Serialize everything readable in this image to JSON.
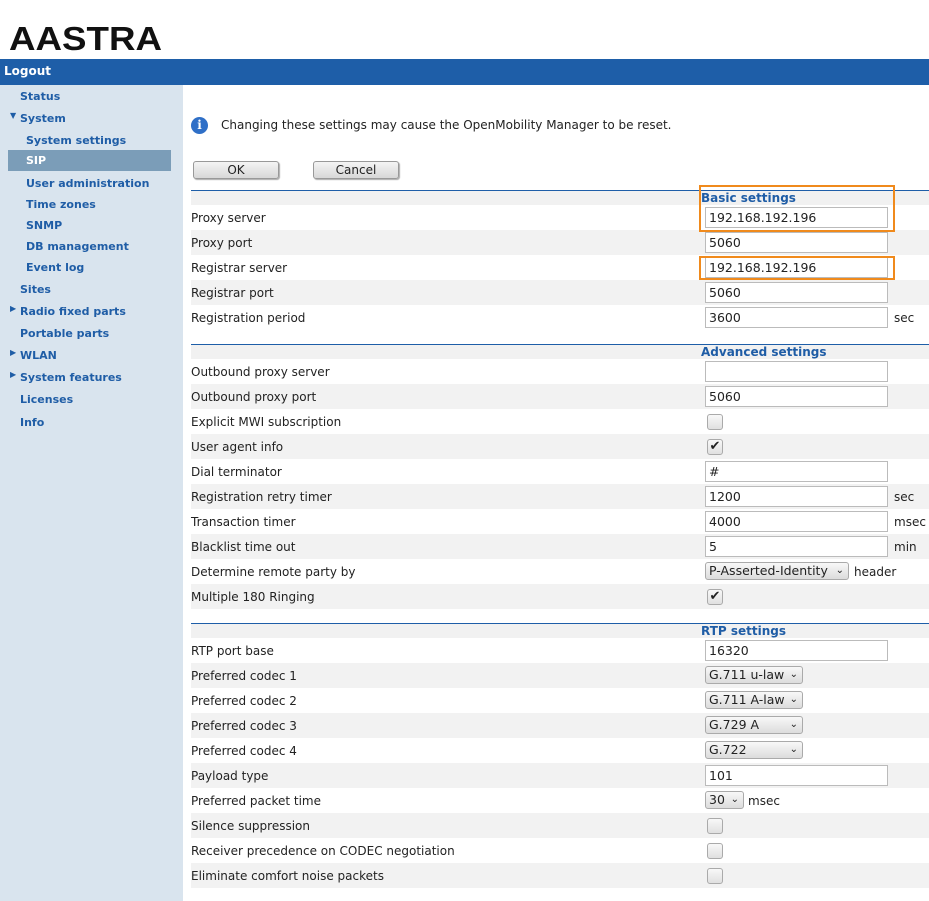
{
  "brand": {
    "logo_text": "AASTRA"
  },
  "header": {
    "logout": "Logout"
  },
  "nav": {
    "status": "Status",
    "system": "System",
    "system_settings": "System settings",
    "sip": "SIP",
    "user_administration": "User administration",
    "time_zones": "Time zones",
    "snmp": "SNMP",
    "db_management": "DB management",
    "event_log": "Event log",
    "sites": "Sites",
    "radio_fixed_parts": "Radio fixed parts",
    "portable_parts": "Portable parts",
    "wlan": "WLAN",
    "system_features": "System features",
    "licenses": "Licenses",
    "info": "Info"
  },
  "notice": "Changing these settings may cause the OpenMobility Manager to be reset.",
  "buttons": {
    "ok": "OK",
    "cancel": "Cancel"
  },
  "basic": {
    "title": "Basic settings",
    "proxy_server": {
      "label": "Proxy server",
      "value": "192.168.192.196"
    },
    "proxy_port": {
      "label": "Proxy port",
      "value": "5060"
    },
    "registrar_server": {
      "label": "Registrar server",
      "value": "192.168.192.196"
    },
    "registrar_port": {
      "label": "Registrar port",
      "value": "5060"
    },
    "registration_period": {
      "label": "Registration period",
      "value": "3600",
      "unit": "sec"
    }
  },
  "advanced": {
    "title": "Advanced settings",
    "outbound_proxy_server": {
      "label": "Outbound proxy server",
      "value": ""
    },
    "outbound_proxy_port": {
      "label": "Outbound proxy port",
      "value": "5060"
    },
    "explicit_mwi": {
      "label": "Explicit MWI subscription",
      "checked": false
    },
    "user_agent_info": {
      "label": "User agent info",
      "checked": true
    },
    "dial_terminator": {
      "label": "Dial terminator",
      "value": "#"
    },
    "registration_retry_timer": {
      "label": "Registration retry timer",
      "value": "1200",
      "unit": "sec"
    },
    "transaction_timer": {
      "label": "Transaction timer",
      "value": "4000",
      "unit": "msec"
    },
    "blacklist_time_out": {
      "label": "Blacklist time out",
      "value": "5",
      "unit": "min"
    },
    "remote_party": {
      "label": "Determine remote party by",
      "value": "P-Asserted-Identity",
      "unit": "header"
    },
    "multiple_180": {
      "label": "Multiple 180 Ringing",
      "checked": true
    }
  },
  "rtp": {
    "title": "RTP settings",
    "rtp_port_base": {
      "label": "RTP port base",
      "value": "16320"
    },
    "codec1": {
      "label": "Preferred codec 1",
      "value": "G.711 u-law"
    },
    "codec2": {
      "label": "Preferred codec 2",
      "value": "G.711 A-law"
    },
    "codec3": {
      "label": "Preferred codec 3",
      "value": "G.729 A"
    },
    "codec4": {
      "label": "Preferred codec 4",
      "value": "G.722"
    },
    "payload_type": {
      "label": "Payload type",
      "value": "101"
    },
    "packet_time": {
      "label": "Preferred packet time",
      "value": "30",
      "unit": "msec"
    },
    "silence_suppression": {
      "label": "Silence suppression",
      "checked": false
    },
    "receiver_precedence": {
      "label": "Receiver precedence on CODEC negotiation",
      "checked": false
    },
    "eliminate_cn": {
      "label": "Eliminate comfort noise packets",
      "checked": false
    }
  },
  "colors": {
    "accent": "#1e5ea8",
    "sidebar": "#d9e4ee",
    "selected": "#7b9db8",
    "highlight": "#f08a1c"
  }
}
